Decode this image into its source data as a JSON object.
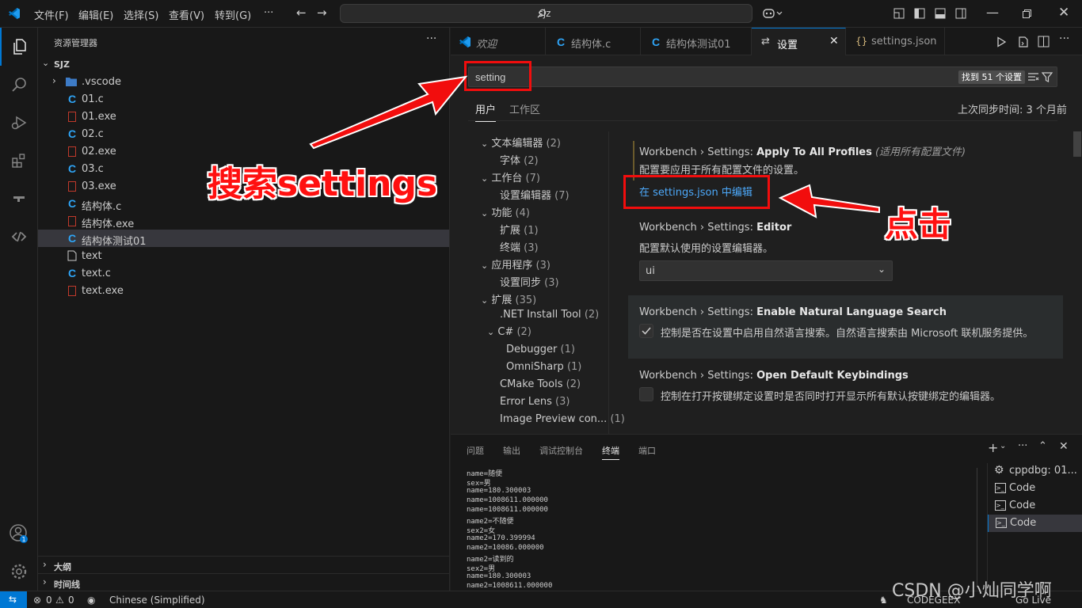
{
  "titlebar": {
    "menus": [
      "文件(F)",
      "编辑(E)",
      "选择(S)",
      "查看(V)",
      "转到(G)",
      "···"
    ],
    "search_text": "sjz"
  },
  "explorer": {
    "header": "资源管理器",
    "more": "···",
    "root": "SJZ",
    "items": [
      {
        "label": ".vscode",
        "icon": "vscode-folder-icon"
      },
      {
        "label": "01.c",
        "icon": "c-file-icon"
      },
      {
        "label": "01.exe",
        "icon": "exe-file-icon"
      },
      {
        "label": "02.c",
        "icon": "c-file-icon"
      },
      {
        "label": "02.exe",
        "icon": "exe-file-icon"
      },
      {
        "label": "03.c",
        "icon": "c-file-icon"
      },
      {
        "label": "03.exe",
        "icon": "exe-file-icon"
      },
      {
        "label": "结构体.c",
        "icon": "c-file-icon"
      },
      {
        "label": "结构体.exe",
        "icon": "exe-file-icon"
      },
      {
        "label": "结构体测试01",
        "icon": "c-file-icon"
      },
      {
        "label": "text",
        "icon": "text-file-icon"
      },
      {
        "label": "text.c",
        "icon": "c-file-icon"
      },
      {
        "label": "text.exe",
        "icon": "exe-file-icon"
      }
    ],
    "outline": "大纲",
    "timeline": "时间线"
  },
  "tabs": [
    "欢迎",
    "结构体.c",
    "结构体测试01",
    "设置",
    "settings.json"
  ],
  "settings": {
    "search_value": "setting",
    "found": "找到 51 个设置",
    "scope_tabs": [
      "用户",
      "工作区"
    ],
    "last_sync": "上次同步时间: 3 个月前",
    "toc": [
      {
        "label": "文本编辑器",
        "count": "(2)"
      },
      {
        "label": "字体",
        "count": "(2)"
      },
      {
        "label": "工作台",
        "count": "(7)"
      },
      {
        "label": "设置编辑器",
        "count": "(7)"
      },
      {
        "label": "功能",
        "count": "(4)"
      },
      {
        "label": "扩展",
        "count": "(1)"
      },
      {
        "label": "终端",
        "count": "(3)"
      },
      {
        "label": "应用程序",
        "count": "(3)"
      },
      {
        "label": "设置同步",
        "count": "(3)"
      },
      {
        "label": "扩展",
        "count": "(35)"
      },
      {
        "label": ".NET Install Tool",
        "count": "(2)"
      },
      {
        "label": "C#",
        "count": "(2)"
      },
      {
        "label": "Debugger",
        "count": "(1)"
      },
      {
        "label": "OmniSharp",
        "count": "(1)"
      },
      {
        "label": "CMake Tools",
        "count": "(2)"
      },
      {
        "label": "Error Lens",
        "count": "(3)"
      },
      {
        "label": "Image Preview con...",
        "count": "(1)"
      }
    ],
    "items": [
      {
        "prefix": "Workbench › Settings: ",
        "name": "Apply To All Profiles",
        "extra": " (适用所有配置文件)",
        "desc": "配置要应用于所有配置文件的设置。",
        "link": "在 settings.json 中编辑"
      },
      {
        "prefix": "Workbench › Settings: ",
        "name": "Editor",
        "desc": "配置默认使用的设置编辑器。",
        "select": "ui"
      },
      {
        "prefix": "Workbench › Settings: ",
        "name": "Enable Natural Language Search",
        "desc": "控制是否在设置中启用自然语言搜索。自然语言搜索由 Microsoft 联机服务提供。",
        "checked": true
      },
      {
        "prefix": "Workbench › Settings: ",
        "name": "Open Default Keybindings",
        "desc": "控制在打开按键绑定设置时是否同时打开显示所有默认按键绑定的编辑器。",
        "checked": false
      }
    ]
  },
  "panel": {
    "tabs": [
      "问题",
      "输出",
      "调试控制台",
      "终端",
      "端口"
    ],
    "terminal_lines": [
      "name=随便",
      "sex=男",
      "name=180.300003",
      "name=1008611.000000",
      "name=1008611.000000",
      "name2=不随便",
      "sex2=女",
      "name2=170.399994",
      "name2=10086.000000",
      "name2=读到的",
      "sex2=男",
      "name=180.300003",
      "name2=1008611.000000"
    ],
    "terminals": [
      "cppdbg: 01...",
      "Code",
      "Code",
      "Code"
    ]
  },
  "statusbar": {
    "errors": "0",
    "warnings": "0",
    "language": "Chinese (Simplified)",
    "codegeex": "CODEGEEX",
    "golive": "Go Live"
  },
  "annotations": {
    "search_note": "搜索settings",
    "click_note": "点击",
    "watermark": "CSDN @小灿同学啊"
  },
  "colors": {
    "accent": "#0078d4",
    "annotation_red": "#f20d0d",
    "link": "#4daafc"
  }
}
